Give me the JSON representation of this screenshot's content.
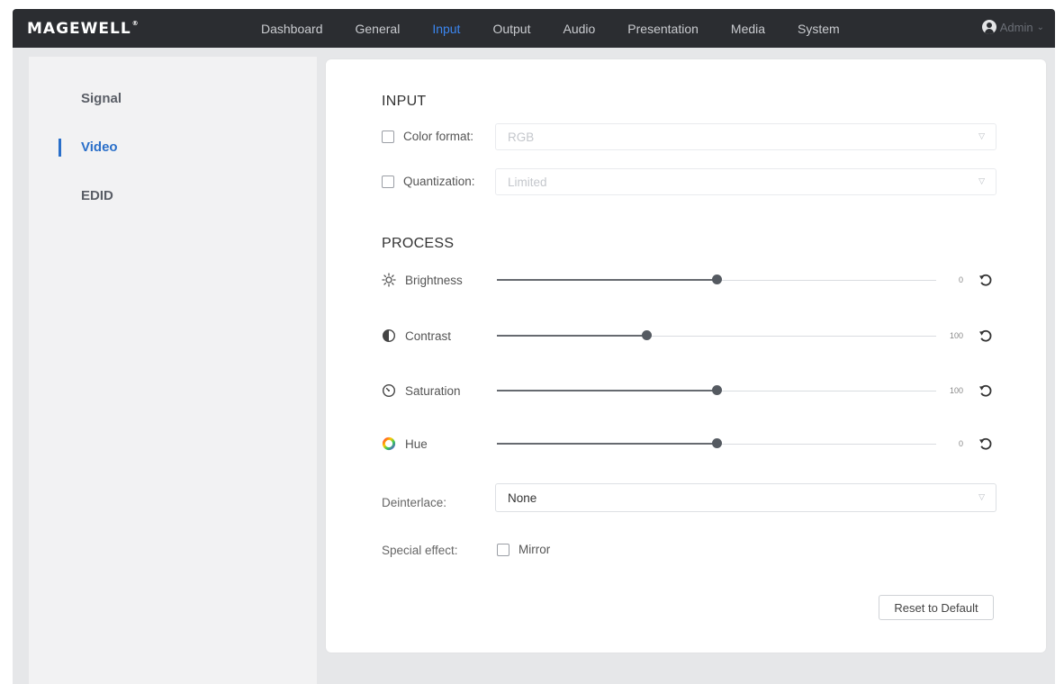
{
  "brand": "MAGEWELL",
  "nav": {
    "items": [
      "Dashboard",
      "General",
      "Input",
      "Output",
      "Audio",
      "Presentation",
      "Media",
      "System"
    ],
    "active": "Input"
  },
  "user": {
    "name": "Admin"
  },
  "sidebar": {
    "items": [
      "Signal",
      "Video",
      "EDID"
    ],
    "active": "Video"
  },
  "input_section": {
    "title": "INPUT",
    "color_format": {
      "label": "Color format:",
      "value": "RGB",
      "checked": false
    },
    "quantization": {
      "label": "Quantization:",
      "value": "Limited",
      "checked": false
    }
  },
  "process_section": {
    "title": "PROCESS",
    "sliders": [
      {
        "label": "Brightness",
        "value": "0",
        "icon": "brightness-icon",
        "level": 0.5
      },
      {
        "label": "Contrast",
        "value": "100",
        "icon": "contrast-icon",
        "level": 0.34
      },
      {
        "label": "Saturation",
        "value": "100",
        "icon": "saturation-icon",
        "level": 0.5
      },
      {
        "label": "Hue",
        "value": "0",
        "icon": "hue-icon",
        "level": 0.5
      }
    ],
    "deinterlace": {
      "label": "Deinterlace:",
      "value": "None"
    },
    "special_effect": {
      "label": "Special effect:",
      "option": "Mirror",
      "checked": false
    }
  },
  "actions": {
    "reset_label": "Reset to Default"
  },
  "colors": {
    "accent": "#3b86f0",
    "topbar": "#2b2d31",
    "active_side": "#2a6fc9"
  }
}
